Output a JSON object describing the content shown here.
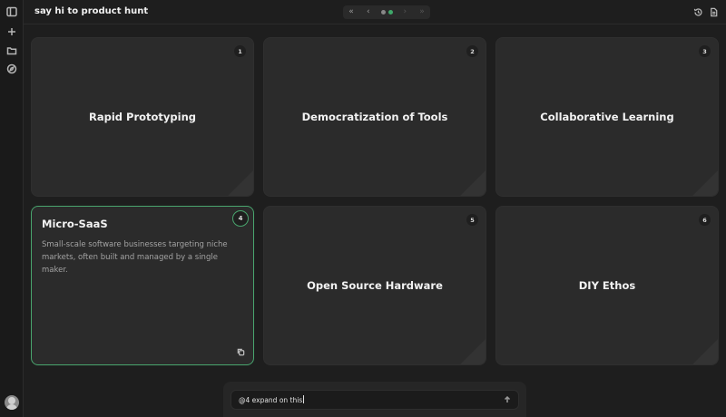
{
  "header": {
    "title": "say hi to product hunt",
    "pager": {
      "first": "«",
      "prev": "‹",
      "next": "›",
      "last": "»",
      "page_count": 2,
      "active_page": 2
    }
  },
  "cards": [
    {
      "number": "1",
      "title": "Rapid Prototyping"
    },
    {
      "number": "2",
      "title": "Democratization of Tools"
    },
    {
      "number": "3",
      "title": "Collaborative Learning"
    },
    {
      "number": "4",
      "title": "Micro-SaaS",
      "description": "Small-scale software businesses targeting niche markets, often built and managed by a single maker.",
      "selected": true
    },
    {
      "number": "5",
      "title": "Open Source Hardware"
    },
    {
      "number": "6",
      "title": "DIY Ethos"
    }
  ],
  "prompt": {
    "value": "@4 expand on this"
  },
  "colors": {
    "accent": "#49a56e",
    "background": "#1e1e1e",
    "card": "#2b2b2b"
  },
  "icons": [
    "sidebar-toggle-icon",
    "plus-icon",
    "folder-icon",
    "compass-icon",
    "history-icon",
    "document-icon",
    "copy-icon",
    "arrow-up-icon",
    "avatar"
  ]
}
